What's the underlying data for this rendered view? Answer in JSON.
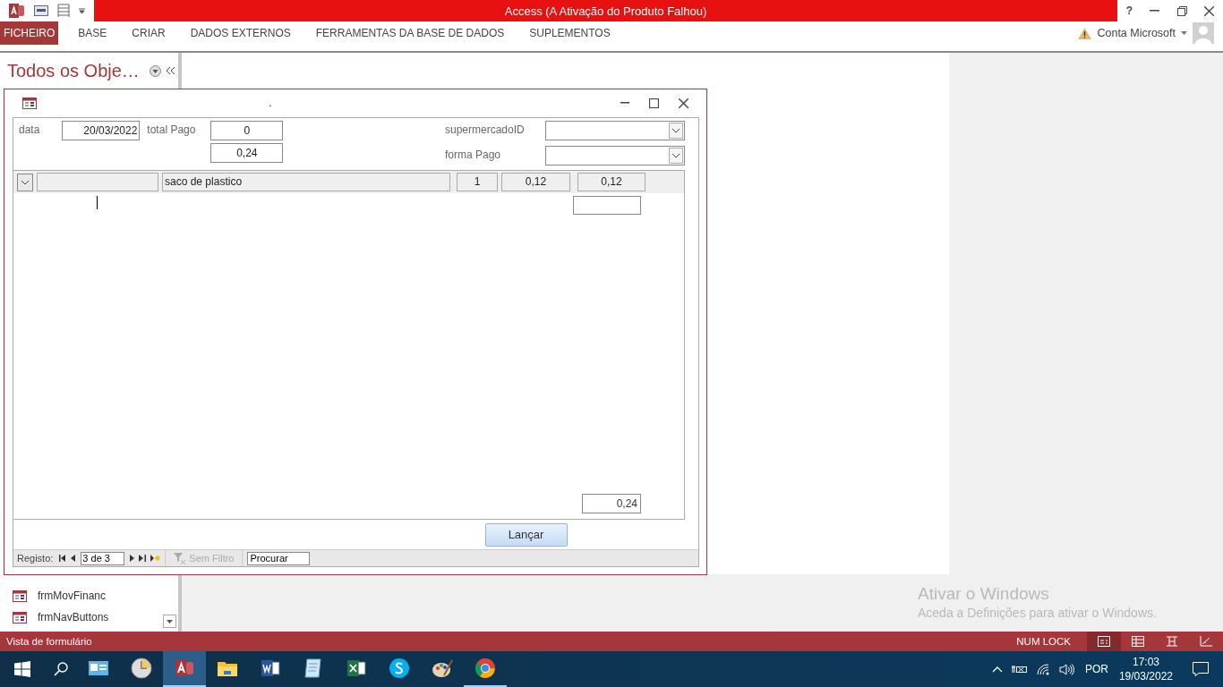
{
  "window": {
    "title": "Access (A Ativação do Produto Falhou)",
    "help": "?"
  },
  "ribbon_tabs": [
    {
      "label": "FICHEIRO",
      "selected": true
    },
    {
      "label": "BASE",
      "selected": false
    },
    {
      "label": "CRIAR",
      "selected": false
    },
    {
      "label": "DADOS EXTERNOS",
      "selected": false
    },
    {
      "label": "FERRAMENTAS DA BASE DE DADOS",
      "selected": false
    },
    {
      "label": "SUPLEMENTOS",
      "selected": false
    }
  ],
  "account": {
    "label": "Conta Microsoft"
  },
  "nav_pane": {
    "title": "Todos os Obje…",
    "items": [
      {
        "label": "frmMovFinanc"
      },
      {
        "label": "frmNavButtons"
      }
    ]
  },
  "form": {
    "title": ".",
    "header": {
      "date_label": "data",
      "date_value": "20/03/2022",
      "total_label": "total Pago",
      "total_value": "0",
      "total_value_2": "0,24",
      "supermarket_label": "supermercadoID",
      "payment_label": "forma Pago"
    },
    "rows": [
      {
        "cells": [
          {
            "kind": "combo"
          },
          {
            "kind": "text"
          },
          {
            "kind": "text",
            "value": "saco de plastico"
          },
          {
            "kind": "text",
            "value": "1"
          },
          {
            "kind": "text",
            "value": "0,12"
          },
          {
            "kind": "text",
            "value": "0,12"
          }
        ]
      }
    ],
    "sum": "0,24",
    "button": "Lançar",
    "record_nav": {
      "label": "Registo:",
      "position": "3 de 3",
      "filter": "Sem Filtro",
      "filter_disabled": true,
      "search": "Procurar"
    }
  },
  "activation": {
    "title": "Ativar o Windows",
    "text": "Aceda a Definições para ativar o Windows."
  },
  "status_bar": {
    "text": "Vista de formulário",
    "num_lock": "NUM LOCK",
    "views": [
      {
        "selected": true
      },
      {
        "selected": false
      },
      {
        "selected": false
      },
      {
        "selected": false
      }
    ]
  },
  "taskbar": {
    "apps": [
      {
        "selected": false,
        "running": false
      },
      {
        "selected": false,
        "running": false
      },
      {
        "selected": true,
        "running": true
      },
      {
        "selected": false,
        "running": false
      },
      {
        "selected": false,
        "running": false
      },
      {
        "selected": false,
        "running": false
      },
      {
        "selected": false,
        "running": false
      },
      {
        "selected": false,
        "running": false
      },
      {
        "selected": false,
        "running": false
      },
      {
        "selected": false,
        "running": true
      }
    ],
    "language": "POR",
    "time": "17:03",
    "date": "19/03/2022"
  }
}
